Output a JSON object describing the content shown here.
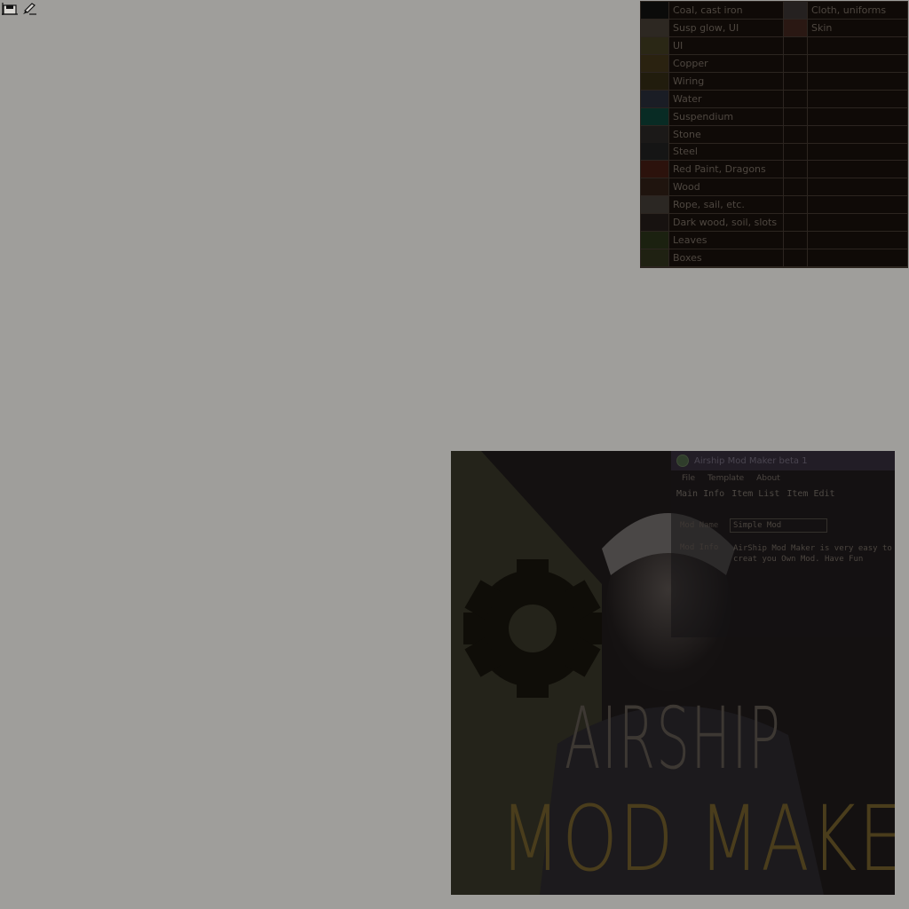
{
  "toolbar": {
    "icons": [
      "save-icon",
      "brush-icon"
    ]
  },
  "palette": {
    "rows": [
      {
        "label": "Coal, cast iron",
        "color": "#0b0b0a"
      },
      {
        "label": "Susp glow, UI",
        "color": "#2d2822"
      },
      {
        "label": "UI",
        "color": "#2a2715"
      },
      {
        "label": "Copper",
        "color": "#2a2210"
      },
      {
        "label": "Wiring",
        "color": "#211c0d"
      },
      {
        "label": "Water",
        "color": "#1a1d25"
      },
      {
        "label": "Suspendium",
        "color": "#082b24"
      },
      {
        "label": "Stone",
        "color": "#1b1918"
      },
      {
        "label": "Steel",
        "color": "#151515"
      },
      {
        "label": "Red Paint, Dragons",
        "color": "#2c120c"
      },
      {
        "label": "Wood",
        "color": "#1f140e"
      },
      {
        "label": "Rope, sail, etc.",
        "color": "#2b2723"
      },
      {
        "label": "Dark wood, soil, slots",
        "color": "#171210"
      },
      {
        "label": "Leaves",
        "color": "#1b2110"
      },
      {
        "label": "Boxes",
        "color": "#1f2112"
      }
    ],
    "second_column": [
      {
        "label": "Cloth, uniforms",
        "color": "#252120"
      },
      {
        "label": "Skin",
        "color": "#2a1813"
      }
    ]
  },
  "cover": {
    "window_title": "Airship Mod Maker beta 1",
    "menu": [
      "File",
      "Template",
      "About"
    ],
    "tabs": [
      "Main Info",
      "Item List",
      "Item Edit"
    ],
    "mod_name_label": "Mod Name",
    "mod_name_value": "Simple Mod",
    "mod_info_label": "Mod Info",
    "mod_info_text": "AirShip Mod Maker is very easy to creat you Own Mod. Have Fun",
    "title_line1": "AIRSHIP",
    "title_line2": "MOD MAKER"
  }
}
